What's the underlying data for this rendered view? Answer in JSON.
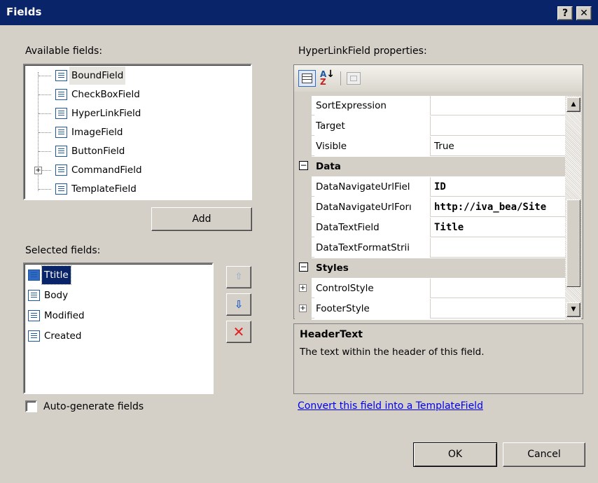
{
  "window": {
    "title": "Fields",
    "help_label": "?",
    "close_label": "✕"
  },
  "available": {
    "label": "Available fields:",
    "items": [
      {
        "label": "BoundField"
      },
      {
        "label": "CheckBoxField"
      },
      {
        "label": "HyperLinkField"
      },
      {
        "label": "ImageField"
      },
      {
        "label": "ButtonField"
      },
      {
        "label": "CommandField",
        "expander": "+"
      },
      {
        "label": "TemplateField"
      }
    ],
    "add_label": "Add"
  },
  "selected": {
    "label": "Selected fields:",
    "items": [
      {
        "label": "Ttitle"
      },
      {
        "label": "Body"
      },
      {
        "label": "Modified"
      },
      {
        "label": "Created"
      }
    ],
    "up_icon": "arrow-up-icon",
    "down_icon": "arrow-down-icon",
    "delete_icon": "red-x-icon"
  },
  "autogen": {
    "label": "Auto-generate fields",
    "checked": false
  },
  "properties": {
    "label": "HyperLinkField properties:",
    "toolbar": {
      "categorized_icon": "categorized-icon",
      "alpha_icon": "alphabetical-icon",
      "pages_icon": "property-pages-icon"
    },
    "rows": [
      {
        "name": "SortExpression",
        "value": ""
      },
      {
        "name": "Target",
        "value": ""
      },
      {
        "name": "Visible",
        "value": "True"
      },
      {
        "name": "Data",
        "category": true,
        "expander": "⊟"
      },
      {
        "name": "DataNavigateUrlFiel",
        "value": "ID",
        "bold": true
      },
      {
        "name": "DataNavigateUrlForı",
        "value": "http://iva_bea/Site",
        "bold": true
      },
      {
        "name": "DataTextField",
        "value": "Title",
        "bold": true
      },
      {
        "name": "DataTextFormatStrii",
        "value": ""
      },
      {
        "name": "Styles",
        "category": true,
        "expander": "⊟"
      },
      {
        "name": "ControlStyle",
        "value": "",
        "expander": "+"
      },
      {
        "name": "FooterStyle",
        "value": "",
        "expander": "+"
      }
    ],
    "help_title": "HeaderText",
    "help_text": "The text within the header of this field."
  },
  "convert_link": "Convert this field into a TemplateField",
  "buttons": {
    "ok": "OK",
    "cancel": "Cancel"
  }
}
